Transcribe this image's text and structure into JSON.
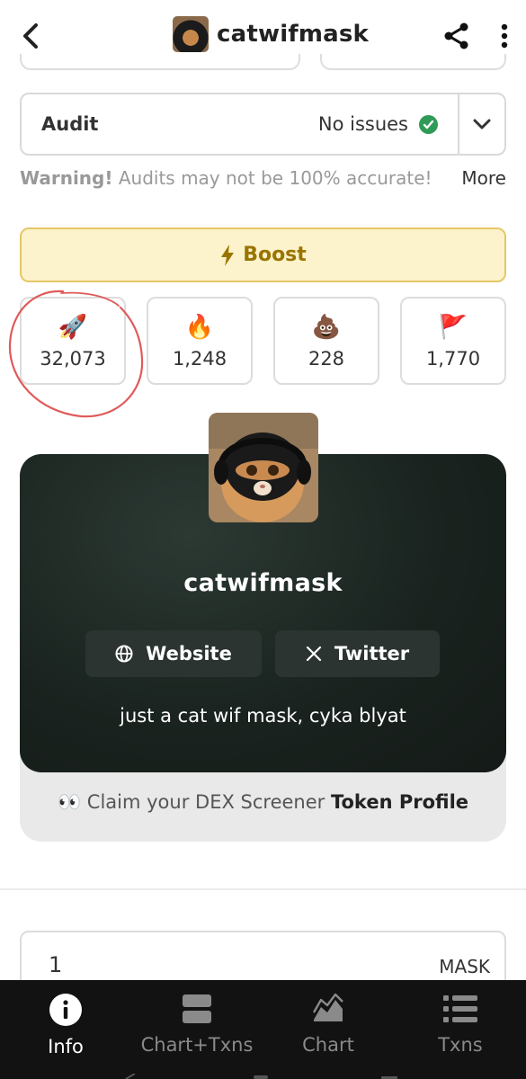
{
  "header": {
    "title": "catwifmask",
    "back_icon": "chevron-left-icon",
    "share_icon": "share-icon",
    "more_icon": "more-vertical-icon"
  },
  "audit": {
    "label": "Audit",
    "status": "No issues",
    "status_icon": "check-circle-icon",
    "toggle_icon": "chevron-down-icon"
  },
  "warning": {
    "bold": "Warning!",
    "text": "Audits may not be 100% accurate!",
    "more": "More"
  },
  "boost": {
    "label": "Boost",
    "icon": "lightning-icon"
  },
  "reactions": [
    {
      "icon": "rocket-icon",
      "emoji": "🚀",
      "count": "32,073"
    },
    {
      "icon": "fire-icon",
      "emoji": "🔥",
      "count": "1,248"
    },
    {
      "icon": "poop-icon",
      "emoji": "💩",
      "count": "228"
    },
    {
      "icon": "flag-icon",
      "emoji": "🚩",
      "count": "1,770"
    }
  ],
  "profile": {
    "name": "catwifmask",
    "website_label": "Website",
    "twitter_label": "Twitter",
    "description": "just a cat wif mask, cyka blyat",
    "claim_prefix": "👀 Claim your DEX Screener",
    "claim_bold": "Token Profile"
  },
  "amount": {
    "value": "1",
    "unit": "MASK"
  },
  "nav": {
    "items": [
      {
        "label": "Info",
        "icon": "info-icon",
        "active": true
      },
      {
        "label": "Chart+Txns",
        "icon": "chart-txns-icon",
        "active": false
      },
      {
        "label": "Chart",
        "icon": "area-chart-icon",
        "active": false
      },
      {
        "label": "Txns",
        "icon": "list-icon",
        "active": false
      }
    ]
  },
  "colors": {
    "boost_bg": "#fcf3cc",
    "boost_text": "#9a7400",
    "profile_bg": "#1a231f",
    "check_green": "#2f9b57",
    "nav_bg": "#121212",
    "annotation_red": "#e05a5a"
  }
}
